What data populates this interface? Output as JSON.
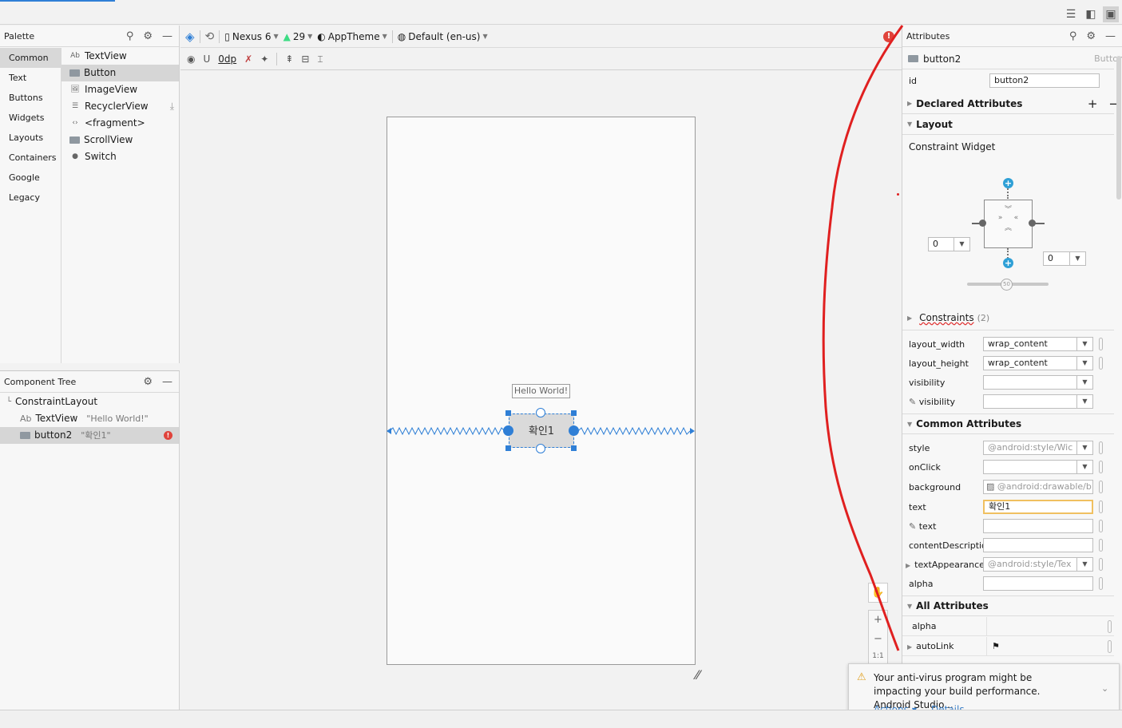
{
  "palette": {
    "title": "Palette",
    "categories": [
      "Common",
      "Text",
      "Buttons",
      "Widgets",
      "Layouts",
      "Containers",
      "Google",
      "Legacy"
    ],
    "widgets": [
      {
        "icon": "Ab",
        "label": "TextView"
      },
      {
        "icon": "button-icon",
        "label": "Button"
      },
      {
        "icon": "image-icon",
        "label": "ImageView"
      },
      {
        "icon": "list-icon",
        "label": "RecyclerView"
      },
      {
        "icon": "<>",
        "label": "<fragment>"
      },
      {
        "icon": "scroll-icon",
        "label": "ScrollView"
      },
      {
        "icon": "switch-icon",
        "label": "Switch"
      }
    ]
  },
  "tree": {
    "title": "Component Tree",
    "nodes": [
      {
        "label": "ConstraintLayout",
        "hint": ""
      },
      {
        "label": "TextView",
        "hint": "\"Hello World!\""
      },
      {
        "label": "button2",
        "hint": "\"확인1\""
      }
    ]
  },
  "toolbar": {
    "device": "Nexus 6",
    "api": "29",
    "theme": "AppTheme",
    "locale": "Default (en-us)",
    "margin": "0dp"
  },
  "canvas": {
    "hello_text": "Hello World!",
    "button_text": "확인1"
  },
  "attributes": {
    "title": "Attributes",
    "component_name": "button2",
    "component_type": "Button",
    "id_label": "id",
    "id_value": "button2",
    "declared": "Declared Attributes",
    "layout": "Layout",
    "constraint_widget": "Constraint Widget",
    "margin_left": "0",
    "margin_right": "0",
    "bias": "50",
    "constraints_label": "Constraints",
    "constraints_count": "(2)",
    "layout_rows": [
      {
        "label": "layout_width",
        "value": "wrap_content"
      },
      {
        "label": "layout_height",
        "value": "wrap_content"
      },
      {
        "label": "visibility",
        "value": ""
      },
      {
        "label": "visibility",
        "value": ""
      }
    ],
    "common": "Common Attributes",
    "common_rows": [
      {
        "label": "style",
        "value": "@android:style/Wic"
      },
      {
        "label": "onClick",
        "value": ""
      },
      {
        "label": "background",
        "value": "@android:drawable/b"
      },
      {
        "label": "text",
        "value": "확인1"
      },
      {
        "label": "text",
        "value": ""
      },
      {
        "label": "contentDescription",
        "value": ""
      },
      {
        "label": "textAppearance",
        "value": "@android:style/Tex"
      },
      {
        "label": "alpha",
        "value": ""
      }
    ],
    "all": "All Attributes",
    "all_rows": [
      {
        "label": "alpha",
        "value": ""
      },
      {
        "label": "autoLink",
        "value": ""
      }
    ]
  },
  "zoom": {
    "ratio": "1:1"
  },
  "notification": {
    "message": "Your anti-virus program might be impacting your build performance. Android Studio...",
    "actions_label": "Actions",
    "details_label": "Details"
  },
  "colors": {
    "accent": "#2f7fd6",
    "error": "#e0433b",
    "annotation": "#e02020"
  }
}
